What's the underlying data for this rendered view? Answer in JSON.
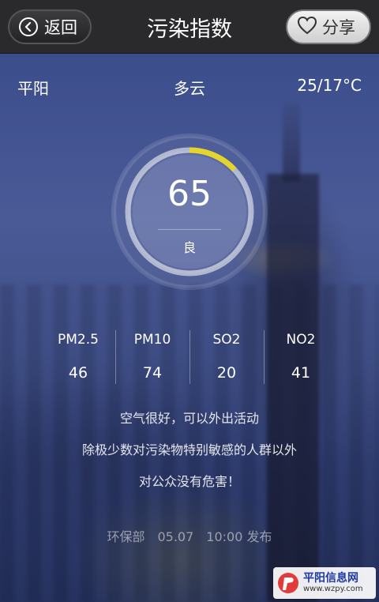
{
  "header": {
    "back_label": "返回",
    "title": "污染指数",
    "share_label": "分享"
  },
  "info": {
    "city": "平阳",
    "weather": "多云",
    "temperature": "25/17°C"
  },
  "aqi": {
    "value": "65",
    "level": "良",
    "fraction": 0.13,
    "ring_color": "#e5d52a"
  },
  "pollutants": [
    {
      "name": "PM2.5",
      "value": "46"
    },
    {
      "name": "PM10",
      "value": "74"
    },
    {
      "name": "SO2",
      "value": "20"
    },
    {
      "name": "NO2",
      "value": "41"
    }
  ],
  "description": {
    "line1": "空气很好，可以外出活动",
    "line2": "除极少数对污染物特别敏感的人群以外",
    "line3": "对公众没有危害！"
  },
  "publish": "环保部　05.07　10:00 发布",
  "watermark": {
    "name": "平阳信息网",
    "url": "www.wzpy.com"
  }
}
